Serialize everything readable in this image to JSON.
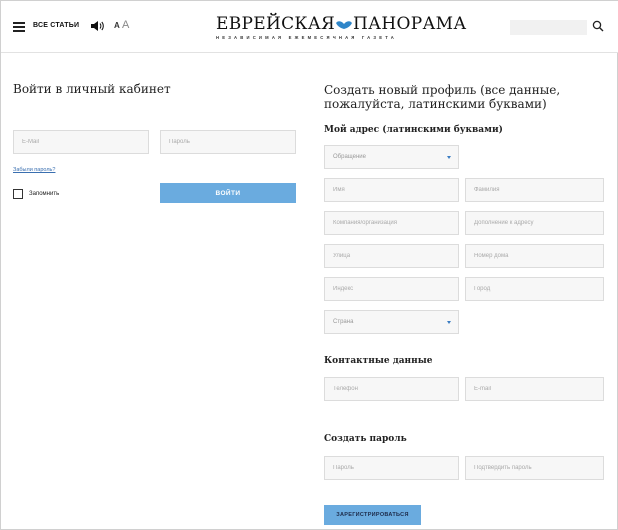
{
  "header": {
    "all_articles": "ВСЕ СТАТЬИ",
    "font_small": "А",
    "font_big": "А",
    "logo_left": "ЕВРЕЙСКАЯ",
    "logo_right": "ПАНОРАМА",
    "logo_sub": "НЕЗАВИСИМАЯ ЕЖЕМЕСЯЧНАЯ ГАЗЕТА",
    "search_placeholder": ""
  },
  "login": {
    "title": "Войти в личный кабинет",
    "email_placeholder": "E-Mail",
    "password_placeholder": "Пароль",
    "forgot": "Забыли пароль?",
    "remember": "Запомнить",
    "submit": "ВОЙТИ"
  },
  "register": {
    "title": "Создать новый профиль (все данные, пожалуйста, латинскими буквами)",
    "address_title": "Мой адрес (латинскими буквами)",
    "salutation": "Обращение",
    "first_name": "Имя",
    "last_name": "Фамилия",
    "company": "Компания/организация",
    "address_extra": "Дополнение к адресу",
    "street": "Улица",
    "house": "Номер дома",
    "zip": "Индекс",
    "city": "Город",
    "country": "Страна",
    "contact_title": "Контактные данные",
    "phone": "Телефон",
    "email": "E-mail",
    "password_title": "Создать пароль",
    "password": "Пароль",
    "password_confirm": "Подтвердить пароль",
    "submit": "ЗАРЕГИСТРИРОВАТЬСЯ"
  },
  "colors": {
    "button": "#6aabdf",
    "link": "#3a6fb0",
    "caret": "#3a7cc2"
  }
}
